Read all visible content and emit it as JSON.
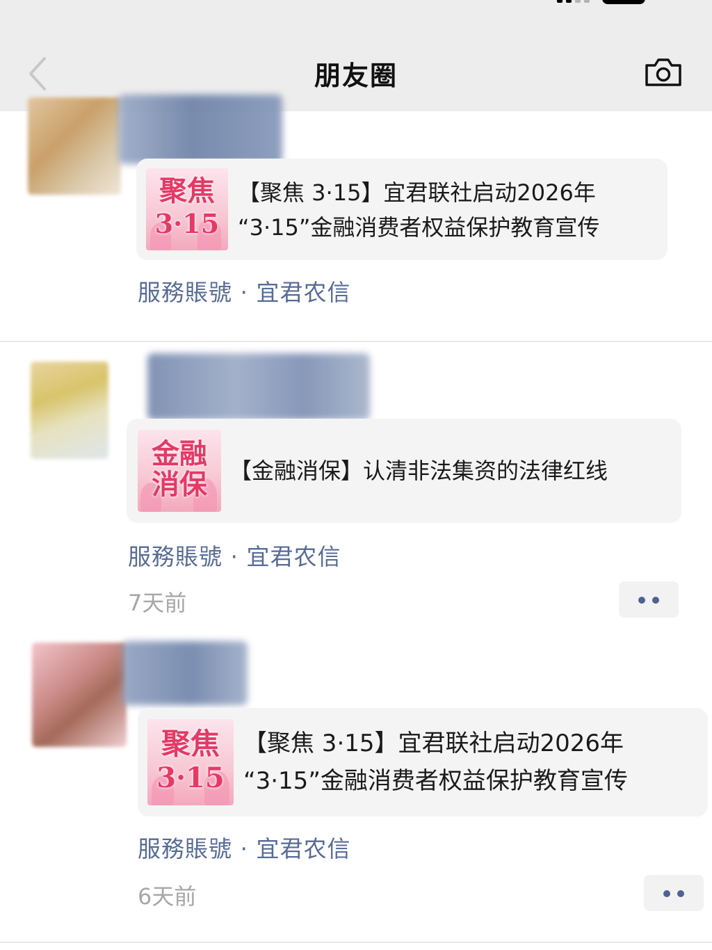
{
  "header": {
    "title": "朋友圈"
  },
  "icons": {
    "back": "chevron-left-icon",
    "camera": "camera-icon",
    "more": "more-dots-icon"
  },
  "colors": {
    "link": "#576b95",
    "timestamp": "#a7a7a7",
    "header_bg": "#ededed",
    "card_bg": "#f4f4f4",
    "thumb_text": "#e53966"
  },
  "posts": [
    {
      "thumb_title_line1": "聚焦",
      "thumb_title_line2": "3·15",
      "article_title_line1": "【聚焦 3·15】宜君联社启动2026年",
      "article_title_line2": "“3·15”金融消费者权益保护教育宣传",
      "account": "服務賬號 · 宜君农信",
      "time": ""
    },
    {
      "thumb_title_line1": "金融",
      "thumb_title_line2": "消保",
      "article_title_line1": "【金融消保】认清非法集资的法律红线",
      "account": "服務賬號 · 宜君农信",
      "time": "7天前"
    },
    {
      "thumb_title_line1": "聚焦",
      "thumb_title_line2": "3·15",
      "article_title_line1": "【聚焦 3·15】宜君联社启动2026年",
      "article_title_line2": "“3·15”金融消费者权益保护教育宣传",
      "account": "服務賬號 · 宜君农信",
      "time": "6天前"
    }
  ]
}
